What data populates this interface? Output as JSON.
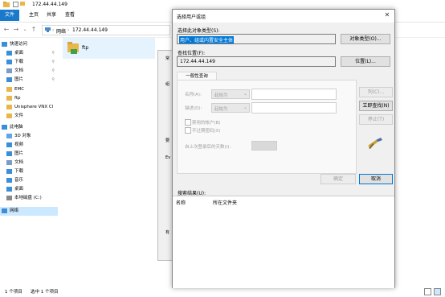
{
  "explorer": {
    "title": "172.44.44.149",
    "ribbon_tabs": [
      "文件",
      "主页",
      "共享",
      "查看"
    ],
    "address": [
      "网络",
      "172.44.44.149"
    ],
    "address_separator": "›",
    "nav": [
      {
        "label": "快速访问",
        "icon": "star-icon",
        "pinned": false
      },
      {
        "label": "桌面",
        "icon": "desktop-icon",
        "pinned": true
      },
      {
        "label": "下载",
        "icon": "download-icon",
        "pinned": true
      },
      {
        "label": "文档",
        "icon": "document-icon",
        "pinned": true
      },
      {
        "label": "图片",
        "icon": "pictures-icon",
        "pinned": true
      },
      {
        "label": "EMC",
        "icon": "folder-icon",
        "pinned": false
      },
      {
        "label": "ftp",
        "icon": "folder-icon",
        "pinned": false
      },
      {
        "label": "Unisphere VNX Cl",
        "icon": "folder-icon",
        "pinned": false
      },
      {
        "label": "文件",
        "icon": "folder-icon",
        "pinned": false
      },
      {
        "label": "此电脑",
        "icon": "computer-icon",
        "pinned": false
      },
      {
        "label": "3D 对象",
        "icon": "3d-objects-icon",
        "pinned": false
      },
      {
        "label": "视频",
        "icon": "video-icon",
        "pinned": false
      },
      {
        "label": "图片",
        "icon": "pictures-icon",
        "pinned": false
      },
      {
        "label": "文档",
        "icon": "document-icon",
        "pinned": false
      },
      {
        "label": "下载",
        "icon": "download-icon",
        "pinned": false
      },
      {
        "label": "音乐",
        "icon": "music-icon",
        "pinned": false
      },
      {
        "label": "桌面",
        "icon": "desktop-icon",
        "pinned": false
      },
      {
        "label": "本地磁盘 (C:)",
        "icon": "drive-icon",
        "pinned": false
      },
      {
        "label": "网络",
        "icon": "network-icon",
        "pinned": false
      }
    ],
    "content_item": "ftp",
    "status_left": "1 个项目",
    "status_right": "选中 1 个项目",
    "behind_labels": [
      "常",
      "组",
      "要",
      "Ev",
      "有"
    ]
  },
  "dialog": {
    "title": "选择用户或组",
    "object_type_label": "选择此对象类型(S):",
    "object_type_value": "用户、组或内置安全主体",
    "object_type_button": "对象类型(O)...",
    "location_label": "查找位置(F):",
    "location_value": "172.44.44.149",
    "location_button": "位置(L)...",
    "tab": "一般性查询",
    "name_label": "名称(A):",
    "name_op": "起始为",
    "desc_label": "描述(D):",
    "desc_op": "起始为",
    "disabled_accounts": "禁用的帐户(B)",
    "no_expire_pw": "不过期密码(X)",
    "days_since_login": "自上次登录后的天数(I):",
    "columns_button": "列(C)...",
    "find_now_button": "立即查找(N)",
    "stop_button": "停止(T)",
    "ok_button": "确定",
    "cancel_button": "取消",
    "results_label": "搜索结果(U):",
    "col_name": "名称",
    "col_folder": "所在文件夹",
    "close_glyph": "✕",
    "accent": "#0078d7"
  }
}
